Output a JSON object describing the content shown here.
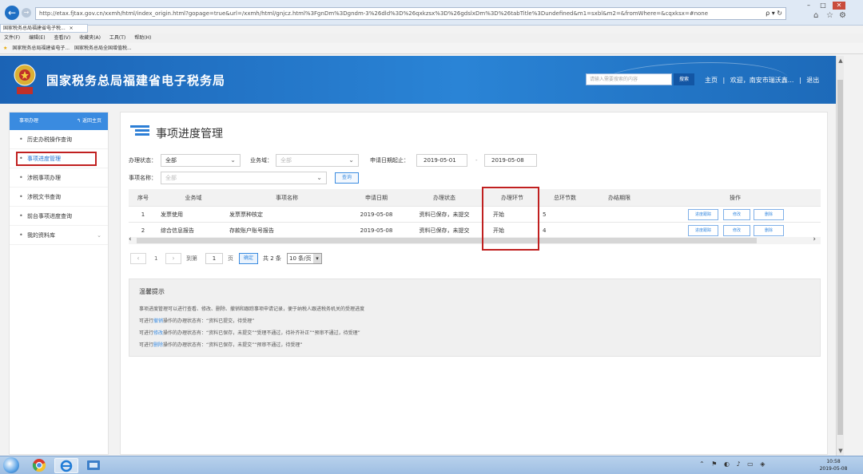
{
  "browser": {
    "url": "http://etax.fjtax.gov.cn/xxmh/html/index_origin.html?gopage=true&url=/xxmh/html/gnjcz.html%3FgnDm%3Dgndm-3%26dld%3D%26qxkzsx%3D%26gdslxDm%3D%26tabTitle%3Dundefined&m1=sxbl&m2=&fromWhere=&cqxksx=#none",
    "tab_title": "国家税务总局福建省电子税...",
    "tab_close": "×",
    "menu": [
      "文件(F)",
      "编辑(E)",
      "查看(V)",
      "收藏夹(A)",
      "工具(T)",
      "帮助(H)"
    ],
    "favorites": [
      "国家税务总局福建省电子...",
      "国家税务总局全国增值税..."
    ],
    "url_icons": "ρ ▾ ↻"
  },
  "header": {
    "site_title": "国家税务总局福建省电子税务局",
    "search_placeholder": "请输入需要搜索的内容",
    "search_button": "搜索",
    "home_link": "主页",
    "welcome": "欢迎，南安市瑞沃鑫...",
    "separator": "|",
    "logout": "退出"
  },
  "sidebar": {
    "title": "事项办理",
    "back": "返回主页",
    "items": [
      {
        "label": "历史办税操作查询"
      },
      {
        "label": "事项进度管理"
      },
      {
        "label": "涉税事项办理"
      },
      {
        "label": "涉税文书查询"
      },
      {
        "label": "前台事项进度查询"
      },
      {
        "label": "我的资料库"
      }
    ]
  },
  "page": {
    "title": "事项进度管理"
  },
  "filters": {
    "status_label": "办理状态：",
    "status_value": "全部",
    "domain_label": "业务域：",
    "domain_value": "全部",
    "date_label": "申请日期起止：",
    "date_from": "2019-05-01",
    "date_sep": "-",
    "date_to": "2019-05-08",
    "item_label": "事项名称：",
    "item_value": "全部",
    "query_button": "查询"
  },
  "table": {
    "headers": [
      "序号",
      "业务域",
      "事项名称",
      "申请日期",
      "办理状态",
      "办理环节",
      "总环节数",
      "办结期限",
      "操作"
    ],
    "rows": [
      {
        "no": "1",
        "domain": "发票使用",
        "name": "发票票种核定",
        "date": "2019-05-08",
        "status": "资料已保存，未提交",
        "stage": "开始",
        "total": "5",
        "deadline": ""
      },
      {
        "no": "2",
        "domain": "综合信息报告",
        "name": "存款账户账号报告",
        "date": "2019-05-08",
        "status": "资料已保存，未提交",
        "stage": "开始",
        "total": "4",
        "deadline": ""
      }
    ],
    "ops": {
      "track": "进度跟踪",
      "edit": "修改",
      "delete": "删除"
    }
  },
  "pagination": {
    "prev": "‹",
    "current": "1",
    "next": "›",
    "goto": "到第",
    "goto_value": "1",
    "page_unit": "页",
    "confirm": "确定",
    "total": "共 2 条",
    "page_size": "10 条/页"
  },
  "tips": {
    "title": "温馨提示",
    "line1": "事项进度管理可以进行查看、修改、删除、撤销和跟踪事项申请记录，便于纳税人跟进税务机关的受理进度",
    "line2_pre": "可进行",
    "line2_key": "撤销",
    "line2_post": "操作的办理状态有：“资料已提交，待受理”",
    "line3_pre": "可进行",
    "line3_key": "修改",
    "line3_post": "操作的办理状态有：“资料已保存，未提交”“受理不通过，待补齐补正”“预审不通过，待受理”",
    "line4_pre": "可进行",
    "line4_key": "删除",
    "line4_post": "操作的办理状态有：“资料已保存，未提交”“预审不通过，待受理”"
  },
  "taskbar": {
    "time": "10:58",
    "date": "2019-05-08"
  }
}
